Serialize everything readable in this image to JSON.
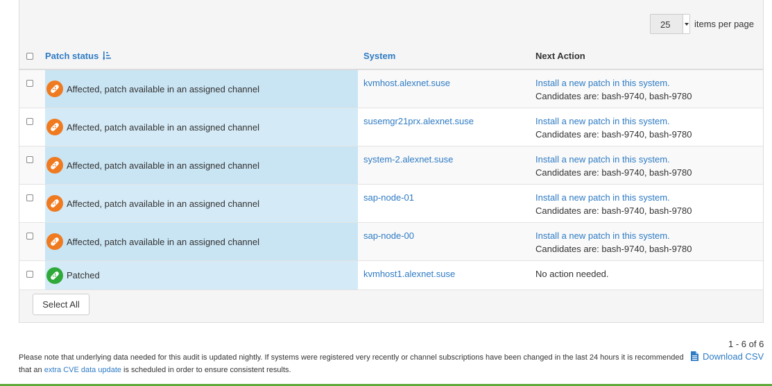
{
  "pager": {
    "per_page_value": "25",
    "per_page_label": "items per page"
  },
  "table": {
    "headers": {
      "status": "Patch status",
      "system": "System",
      "action": "Next Action"
    },
    "rows": [
      {
        "status": "Affected, patch available in an assigned channel",
        "status_icon": "patch-affected-icon",
        "system": "kvmhost.alexnet.suse",
        "action_link": "Install a new patch in this system.",
        "action_text": "Candidates are: bash-9740, bash-9780"
      },
      {
        "status": "Affected, patch available in an assigned channel",
        "status_icon": "patch-affected-icon",
        "system": "susemgr21prx.alexnet.suse",
        "action_link": "Install a new patch in this system.",
        "action_text": "Candidates are: bash-9740, bash-9780"
      },
      {
        "status": "Affected, patch available in an assigned channel",
        "status_icon": "patch-affected-icon",
        "system": "system-2.alexnet.suse",
        "action_link": "Install a new patch in this system.",
        "action_text": "Candidates are: bash-9740, bash-9780"
      },
      {
        "status": "Affected, patch available in an assigned channel",
        "status_icon": "patch-affected-icon",
        "system": "sap-node-01",
        "action_link": "Install a new patch in this system.",
        "action_text": "Candidates are: bash-9740, bash-9780"
      },
      {
        "status": "Affected, patch available in an assigned channel",
        "status_icon": "patch-affected-icon",
        "system": "sap-node-00",
        "action_link": "Install a new patch in this system.",
        "action_text": "Candidates are: bash-9740, bash-9780"
      },
      {
        "status": "Patched",
        "status_icon": "patch-ok-icon",
        "system": "kvmhost1.alexnet.suse",
        "action_link": "",
        "action_text": "No action needed."
      }
    ]
  },
  "select_all_label": "Select All",
  "range_text": "1 - 6 of 6",
  "note": {
    "part1": "Please note that underlying data needed for this audit is updated nightly. If systems were registered very recently or channel subscriptions have been changed in the last 24 hours it is recommended that an ",
    "link": "extra CVE data update",
    "part2": " is scheduled in order to ensure consistent results."
  },
  "download_csv_label": "Download CSV",
  "colors": {
    "link": "#2e7bc4",
    "affected": "#ef7a1f",
    "patched": "#30a93b",
    "status_bg": "#d4eaf6",
    "footer_accent": "#5fa93a"
  }
}
